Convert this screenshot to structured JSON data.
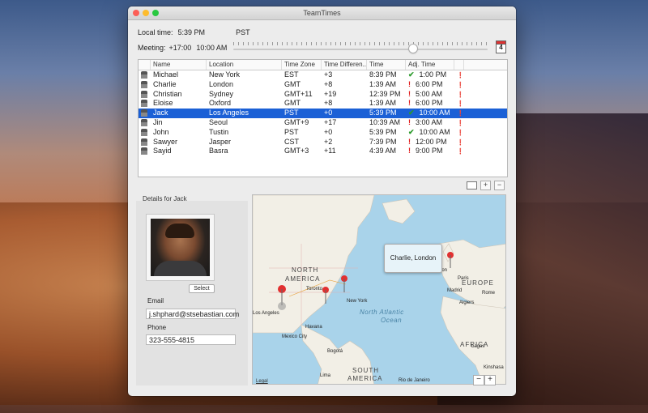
{
  "window": {
    "title": "TeamTimes"
  },
  "info": {
    "local_label": "Local time:",
    "local_time": "5:39 PM",
    "local_zone": "PST",
    "meeting_label": "Meeting:",
    "meeting_offset": "+17:00",
    "meeting_time": "10:00 AM",
    "calendar_day": "4"
  },
  "table": {
    "headers": [
      "",
      "Name",
      "Location",
      "Time Zone",
      "Time Differen...",
      "Time",
      "Adj. Time",
      ""
    ],
    "rows": [
      {
        "name": "Michael",
        "location": "New York",
        "tz": "EST",
        "diff": "+3",
        "time": "8:39 PM",
        "adj_mark": "✔",
        "adj_ok": true,
        "adj": "1:00 PM"
      },
      {
        "name": "Charlie",
        "location": "London",
        "tz": "GMT",
        "diff": "+8",
        "time": "1:39 AM",
        "adj_mark": "!",
        "adj_ok": false,
        "adj": "6:00 PM"
      },
      {
        "name": "Christian",
        "location": "Sydney",
        "tz": "GMT+11",
        "diff": "+19",
        "time": "12:39 PM",
        "adj_mark": "!",
        "adj_ok": false,
        "adj": "5:00 AM"
      },
      {
        "name": "Eloise",
        "location": "Oxford",
        "tz": "GMT",
        "diff": "+8",
        "time": "1:39 AM",
        "adj_mark": "!",
        "adj_ok": false,
        "adj": "6:00 PM"
      },
      {
        "name": "Jack",
        "location": "Los Angeles",
        "tz": "PST",
        "diff": "+0",
        "time": "5:39 PM",
        "adj_mark": "✔",
        "adj_ok": true,
        "adj": "10:00 AM",
        "selected": true
      },
      {
        "name": "Jin",
        "location": "Seoul",
        "tz": "GMT+9",
        "diff": "+17",
        "time": "10:39 AM",
        "adj_mark": "!",
        "adj_ok": false,
        "adj": "3:00 AM"
      },
      {
        "name": "John",
        "location": "Tustin",
        "tz": "PST",
        "diff": "+0",
        "time": "5:39 PM",
        "adj_mark": "✔",
        "adj_ok": true,
        "adj": "10:00 AM"
      },
      {
        "name": "Sawyer",
        "location": "Jasper",
        "tz": "CST",
        "diff": "+2",
        "time": "7:39 PM",
        "adj_mark": "!",
        "adj_ok": false,
        "adj": "12:00 PM"
      },
      {
        "name": "Sayid",
        "location": "Basra",
        "tz": "GMT+3",
        "diff": "+11",
        "time": "4:39 AM",
        "adj_mark": "!",
        "adj_ok": false,
        "adj": "9:00 PM"
      }
    ],
    "buttons": {
      "add": "+",
      "remove": "−"
    }
  },
  "details": {
    "title": "Details for Jack",
    "select_label": "Select",
    "email_label": "Email",
    "email_value": "j.shphard@stsebastian.com",
    "phone_label": "Phone",
    "phone_value": "323-555-4815"
  },
  "map": {
    "callout": "Charlie, London",
    "labels": {
      "north": "NORTH",
      "america": "AMERICA",
      "europe": "EUROPE",
      "africa": "AFRICA",
      "south": "SOUTH",
      "south_america": "AMERICA",
      "ocean1": "North Atlantic",
      "ocean2": "Ocean"
    },
    "cities": {
      "toronto": "Toronto",
      "new_york": "New York",
      "los_angeles": "Los Angeles",
      "mexico_city": "Mexico City",
      "bogota": "Bogotá",
      "madrid": "Madrid",
      "paris": "Paris",
      "london": "don",
      "rome": "Rome",
      "algiers": "Algiers",
      "lagos": "Lagos",
      "kinshasa": "Kinshasa",
      "rio": "Rio de Janeiro",
      "lima": "Lima",
      "havana": "Havana"
    },
    "legal": "Legal",
    "zoom_out": "−",
    "zoom_in": "+"
  },
  "colors": {
    "selection": "#1b60d6",
    "ok": "#2a9a2a",
    "warn": "#e01d1d",
    "ocean": "#a9d3ea",
    "land": "#f2efe6"
  }
}
